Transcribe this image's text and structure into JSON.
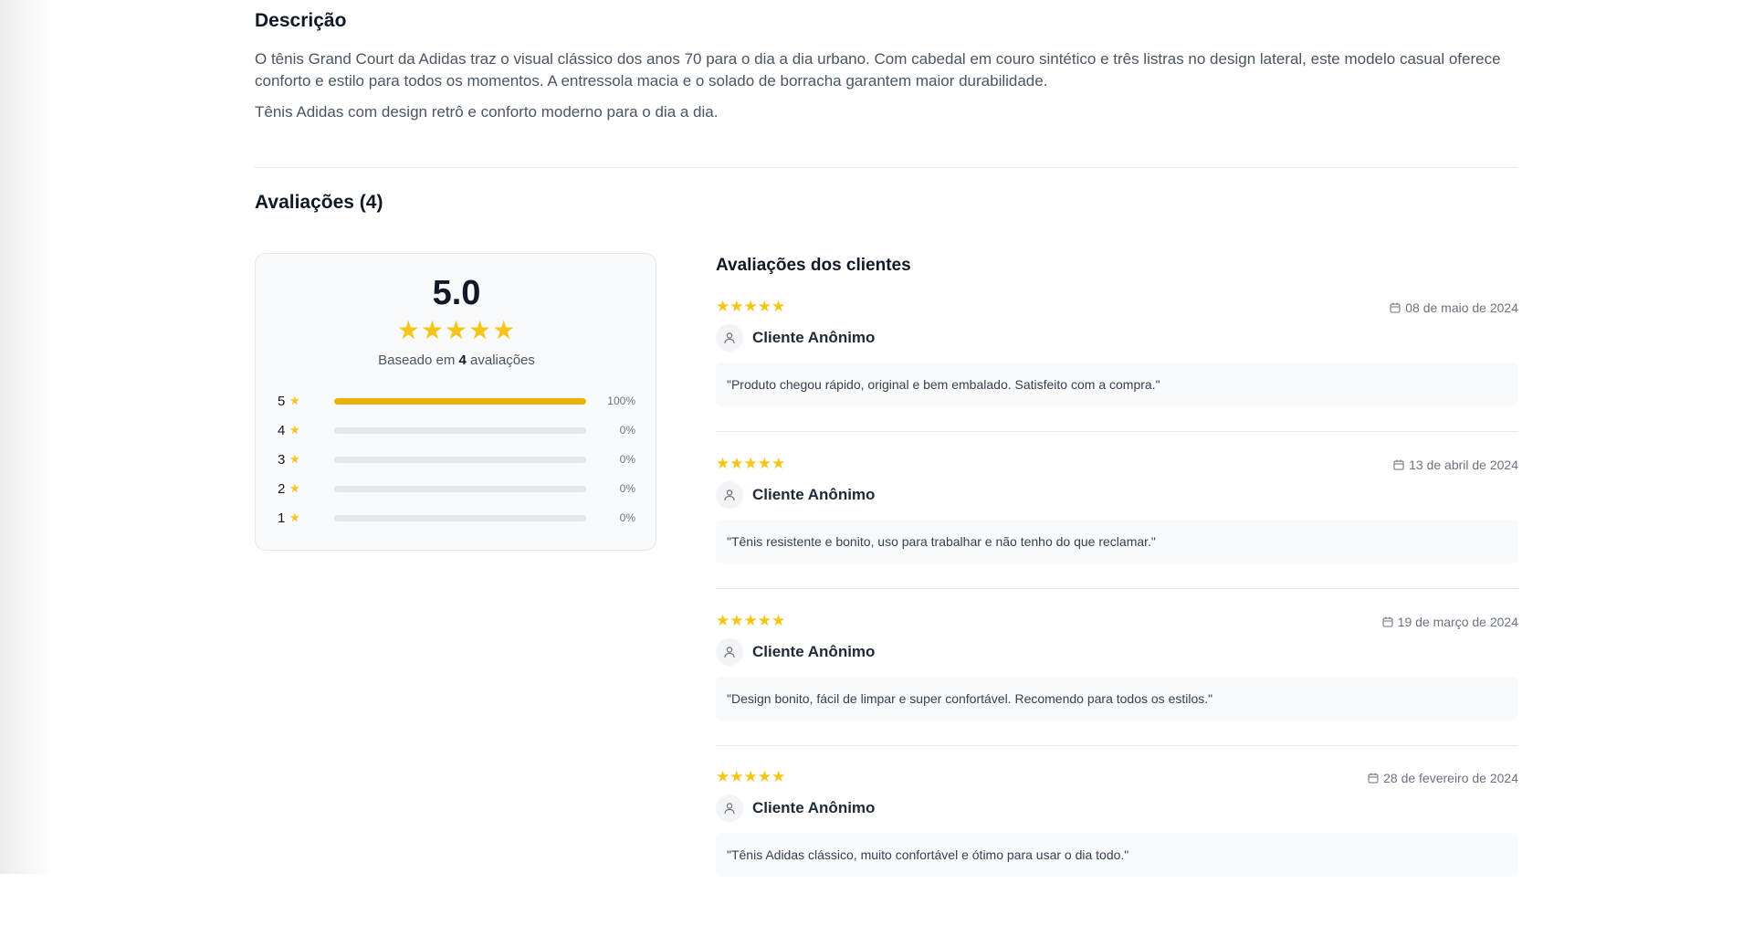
{
  "description": {
    "title": "Descrição",
    "text": "O tênis Grand Court da Adidas traz o visual clássico dos anos 70 para o dia a dia urbano. Com cabedal em couro sintético e três listras no design lateral, este modelo casual oferece conforto e estilo para todos os momentos. A entressola macia e o solado de borracha garantem maior durabilidade.",
    "short": "Tênis Adidas com design retrô e conforto moderno para o dia a dia."
  },
  "reviews": {
    "title": "Avaliações (4)",
    "summary": {
      "average": "5.0",
      "stars": "★★★★★",
      "based_prefix": "Baseado em",
      "count": "4",
      "based_suffix": "avaliações",
      "distribution": [
        {
          "rating": "5",
          "star": "★",
          "percent": 100,
          "label": "100%"
        },
        {
          "rating": "4",
          "star": "★",
          "percent": 0,
          "label": "0%"
        },
        {
          "rating": "3",
          "star": "★",
          "percent": 0,
          "label": "0%"
        },
        {
          "rating": "2",
          "star": "★",
          "percent": 0,
          "label": "0%"
        },
        {
          "rating": "1",
          "star": "★",
          "percent": 0,
          "label": "0%"
        }
      ]
    },
    "list_title": "Avaliações dos clientes",
    "items": [
      {
        "stars": "★★★★★",
        "date": "08 de maio de 2024",
        "author": "Cliente Anônimo",
        "comment": "\"Produto chegou rápido, original e bem embalado. Satisfeito com a compra.\""
      },
      {
        "stars": "★★★★★",
        "date": "13 de abril de 2024",
        "author": "Cliente Anônimo",
        "comment": "\"Tênis resistente e bonito, uso para trabalhar e não tenho do que reclamar.\""
      },
      {
        "stars": "★★★★★",
        "date": "19 de março de 2024",
        "author": "Cliente Anônimo",
        "comment": "\"Design bonito, fácil de limpar e super confortável. Recomendo para todos os estilos.\""
      },
      {
        "stars": "★★★★★",
        "date": "28 de fevereiro de 2024",
        "author": "Cliente Anônimo",
        "comment": "\"Tênis Adidas clássico, muito confortável e ótimo para usar o dia todo.\""
      }
    ]
  },
  "colors": {
    "star": "#f5c518",
    "bar_fill": "#eab308",
    "bar_track": "#e5e7eb"
  }
}
